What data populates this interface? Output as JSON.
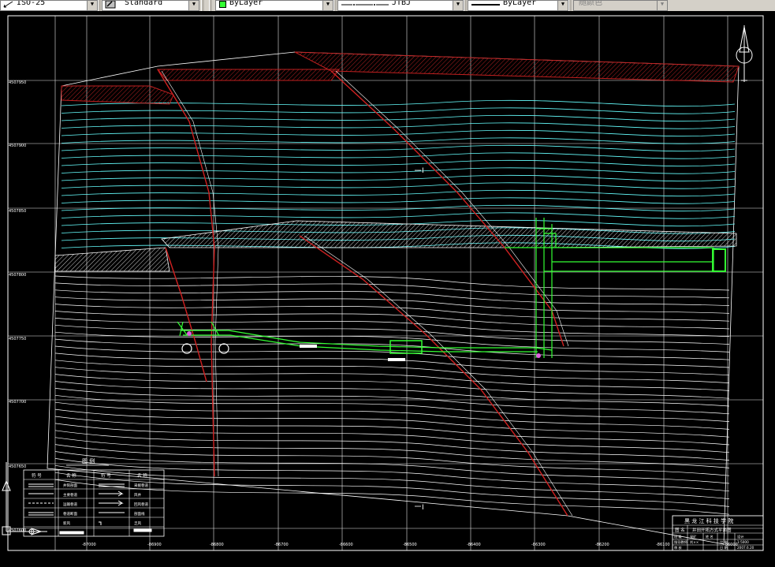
{
  "toolbar": {
    "dimstyle": "ISO-25",
    "textstyle": "Standard",
    "layer": "ByLayer",
    "linetype": "JTBJ",
    "lineweight": "ByLayer",
    "color": "随颜色"
  },
  "drawing": {
    "y_labels": [
      "4507950",
      "4507900",
      "4507850",
      "4507800",
      "4507750",
      "4507700",
      "4507650",
      "4507600"
    ],
    "x_labels": [
      "-87000",
      "-86900",
      "-86800",
      "-86700",
      "-86600",
      "-86500",
      "-86400",
      "-86300",
      "-86200",
      "-86100",
      "-86000"
    ],
    "section_marks": [
      "I",
      "I"
    ],
    "legend": {
      "title": "图   例",
      "headers": [
        "符 号",
        "名 称",
        "符 号",
        "名 称"
      ],
      "items": [
        "井筒剖面",
        "采掘巷道",
        "主要巷道",
        "风井",
        "运输巷道",
        "回风巷道",
        "巷道断面",
        "剖面线",
        "新风",
        "乏风"
      ]
    },
    "title_block": {
      "school": "黑 龙 江 科 技 学 院",
      "fig_label": "图 名",
      "fig_name": "井田开拓方式平面图",
      "row2": [
        "班 级",
        "采矿",
        "姓 名",
        "设计"
      ],
      "row3": [
        "指导教师",
        "刘××",
        "比 例",
        "1:5000"
      ],
      "row4": [
        "审 核",
        "",
        "日 期",
        "2007.6.20"
      ]
    }
  },
  "colors": {
    "background": "#000000",
    "grid": "#ffffff",
    "contour_cyan": "#66ffff",
    "contour_white": "#ffffff",
    "coal_seam": "#a01818",
    "roadway": "#33ff33"
  }
}
